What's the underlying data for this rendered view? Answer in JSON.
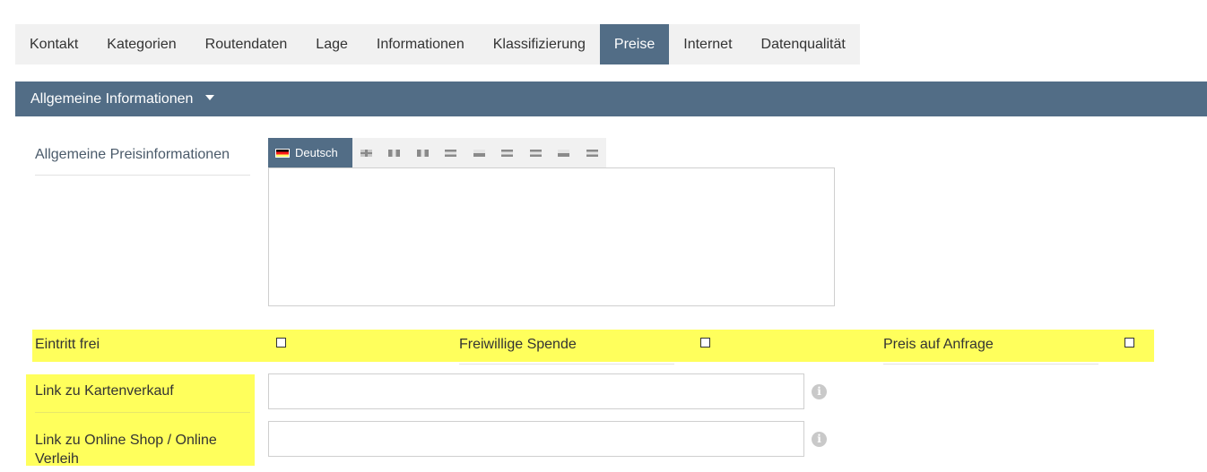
{
  "tabs": [
    {
      "label": "Kontakt",
      "active": false
    },
    {
      "label": "Kategorien",
      "active": false
    },
    {
      "label": "Routendaten",
      "active": false
    },
    {
      "label": "Lage",
      "active": false
    },
    {
      "label": "Informationen",
      "active": false
    },
    {
      "label": "Klassifizierung",
      "active": false
    },
    {
      "label": "Preise",
      "active": true
    },
    {
      "label": "Internet",
      "active": false
    },
    {
      "label": "Datenqualität",
      "active": false
    }
  ],
  "section": {
    "title": "Allgemeine Informationen",
    "icon": "caret-down-icon"
  },
  "price_info": {
    "label": "Allgemeine Preisinformationen",
    "language_active": "Deutsch",
    "language_flags": [
      "flag-uk-icon",
      "flag-fr-icon",
      "flag-it-icon",
      "flag-nl-icon",
      "flag-cz-icon",
      "flag-si-icon",
      "flag-hu-icon",
      "flag-pl-icon",
      "flag-ru-icon"
    ],
    "value": ""
  },
  "checkboxes": [
    {
      "label": "Eintritt frei",
      "checked": false
    },
    {
      "label": "Freiwillige Spende",
      "checked": false
    },
    {
      "label": "Preis auf Anfrage",
      "checked": false
    }
  ],
  "links": [
    {
      "label": "Link zu Kartenverkauf",
      "value": "",
      "icon": "info-icon"
    },
    {
      "label": "Link zu Online Shop / Online Verleih",
      "value": "",
      "icon": "info-icon"
    }
  ],
  "colors": {
    "accent": "#526d86",
    "highlight": "#ffff5c",
    "tab_bg": "#f1f1f1"
  }
}
